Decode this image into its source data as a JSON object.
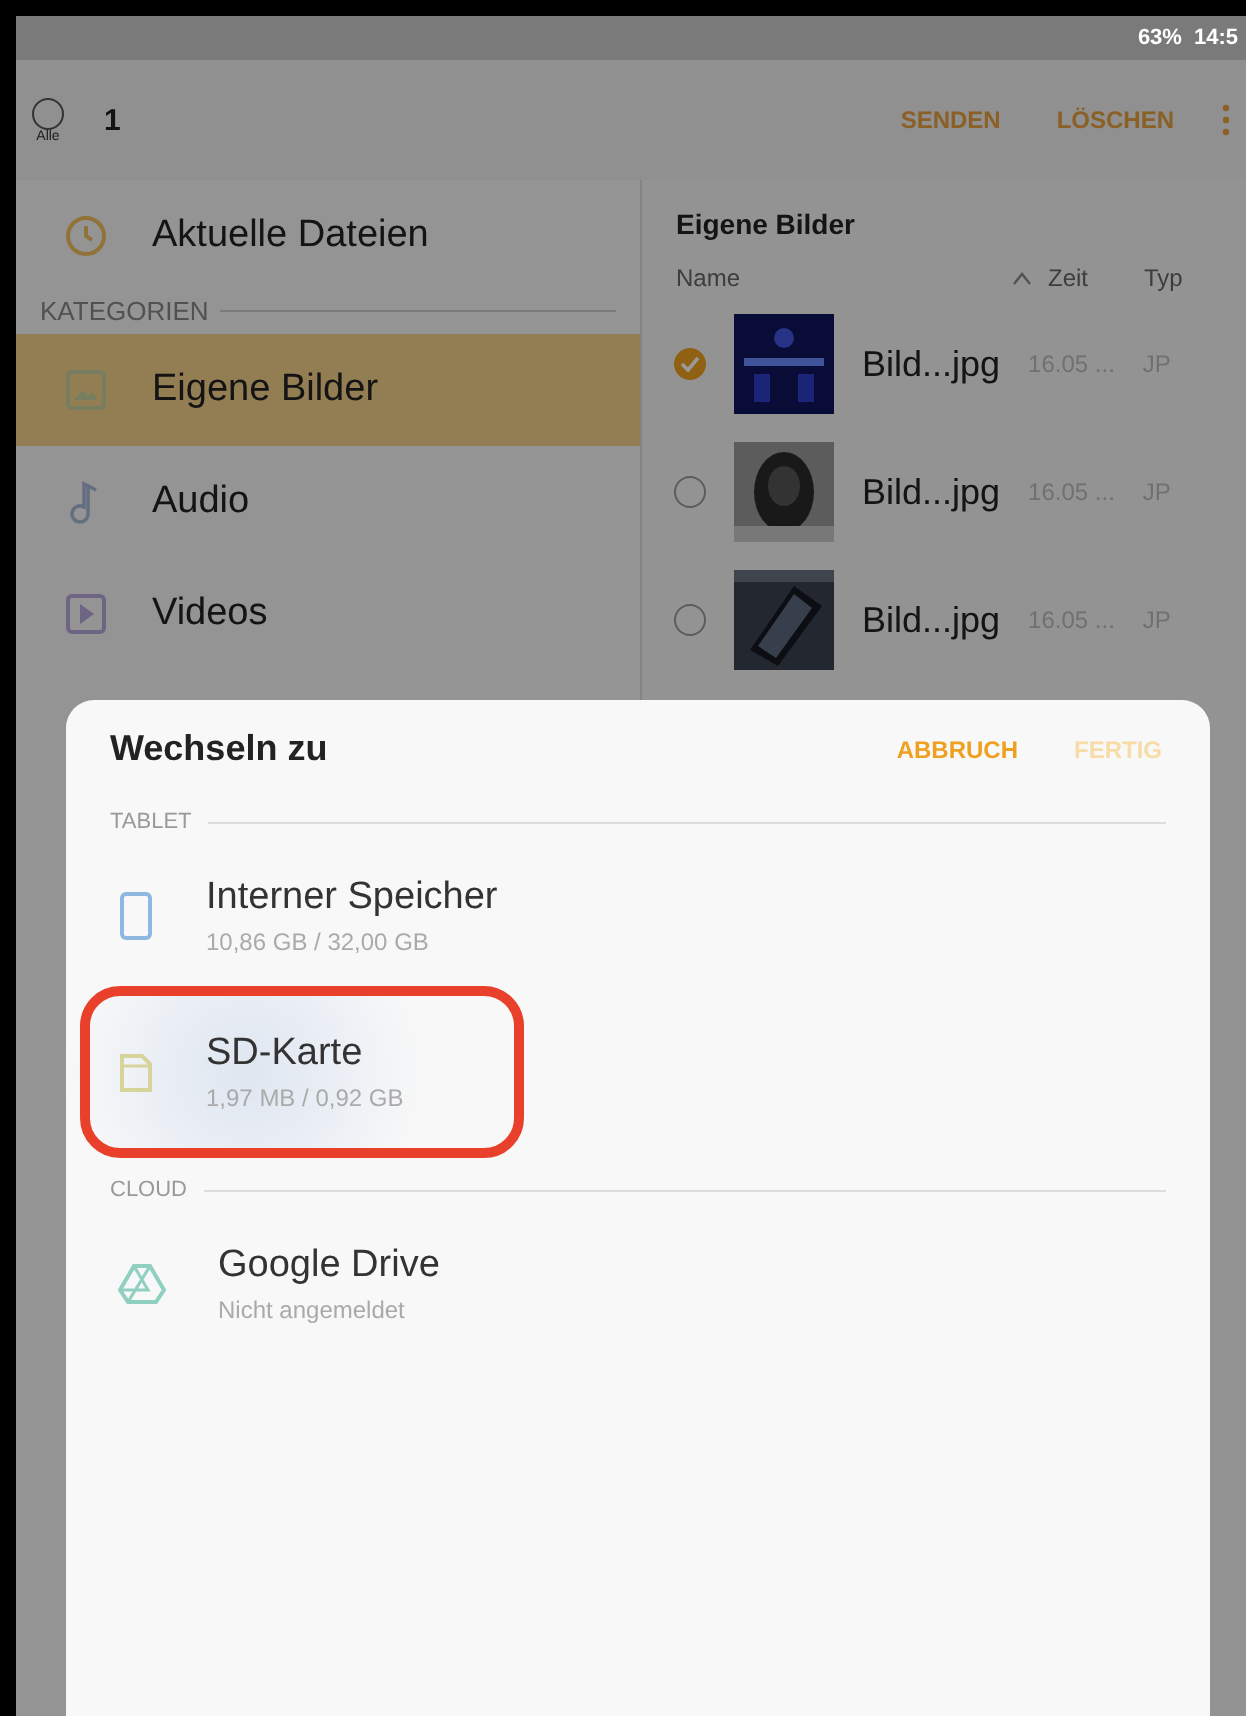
{
  "status_bar": {
    "battery": "63%",
    "time": "14:5"
  },
  "toolbar": {
    "select_all_checked": false,
    "select_all_label": "Alle",
    "selected_count": "1",
    "actions": [
      "SENDEN",
      "LÖSCHEN"
    ]
  },
  "sidebar": {
    "recent": "Aktuelle Dateien",
    "section": "KATEGORIEN",
    "items": [
      {
        "label": "Eigene Bilder",
        "kind": "images",
        "selected": true
      },
      {
        "label": "Audio",
        "kind": "audio",
        "selected": false
      },
      {
        "label": "Videos",
        "kind": "video",
        "selected": false
      }
    ]
  },
  "file_list": {
    "title": "Eigene Bilder",
    "columns": [
      "Name",
      "Zeit",
      "Typ"
    ],
    "rows": [
      {
        "name": "Bild...jpg",
        "time": "16.05 ...",
        "type": "JP",
        "checked": true,
        "kind": "picture"
      },
      {
        "name": "Bild...jpg",
        "time": "16.05 ...",
        "type": "JP",
        "checked": false,
        "kind": "picture"
      },
      {
        "name": "Bild...jpg",
        "time": "16.05 ...",
        "type": "JP",
        "checked": false,
        "kind": "picture"
      }
    ]
  },
  "dialog": {
    "title": "Wechseln zu",
    "cancel": "ABBRUCH",
    "done": {
      "label": "FERTIG",
      "disabled": true
    },
    "sections": [
      {
        "header": "TABLET",
        "items": [
          {
            "name": "Interner Speicher",
            "detail": "10,86 GB / 32,00 GB",
            "kind": "tablet",
            "selected": false
          },
          {
            "name": "SD-Karte",
            "detail": "1,97 MB / 0,92 GB",
            "kind": "sdcard",
            "selected": true
          }
        ]
      },
      {
        "header": "CLOUD",
        "items": [
          {
            "name": "Google Drive",
            "detail": "Nicht angemeldet",
            "kind": "drive",
            "selected": false
          }
        ]
      }
    ]
  }
}
